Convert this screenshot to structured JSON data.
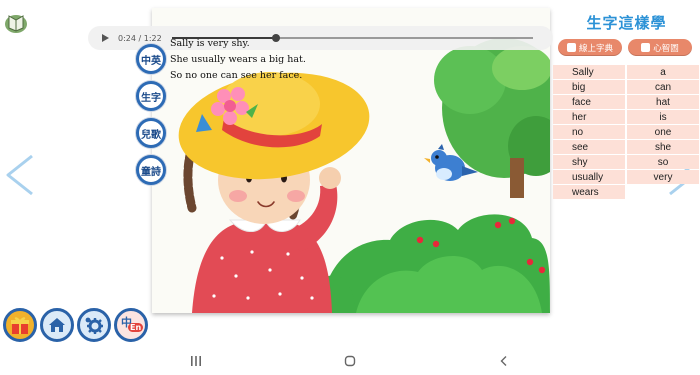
{
  "player": {
    "time_label": "0:24 / 1:22",
    "progress": 0.29
  },
  "story": {
    "lines": [
      "Sally is very shy.",
      "She usually wears a big hat.",
      "So no one can see her face."
    ]
  },
  "side_menu": [
    {
      "label": "中英"
    },
    {
      "label": "生字"
    },
    {
      "label": "兒歌"
    },
    {
      "label": "童詩"
    }
  ],
  "vocab": {
    "title": "生字這樣學",
    "tab_dictionary": "線上字典",
    "tab_mindmap": "心智圖",
    "words": [
      "Sally",
      "a",
      "big",
      "can",
      "face",
      "hat",
      "her",
      "is",
      "no",
      "one",
      "see",
      "she",
      "shy",
      "so",
      "usually",
      "very",
      "wears"
    ]
  },
  "bottom_toolbar": {
    "lang_label": "中",
    "lang_sub": "En"
  },
  "colors": {
    "accent_blue": "#2d6bb5",
    "vocab_title": "#2c92d6",
    "vocab_cell": "#fde0d7",
    "tab_bg": "#e8886a",
    "arrow": "#a9d1ee"
  },
  "icons": {
    "top_left": "book-icon",
    "play": "play-icon",
    "prev": "chevron-left-icon",
    "next": "chevron-right-icon",
    "gift": "gift-icon",
    "home": "home-icon",
    "settings": "gear-icon",
    "language": "language-icon",
    "nav_recent": "recent-apps-icon",
    "nav_home": "home-circle-icon",
    "nav_back": "back-icon"
  }
}
